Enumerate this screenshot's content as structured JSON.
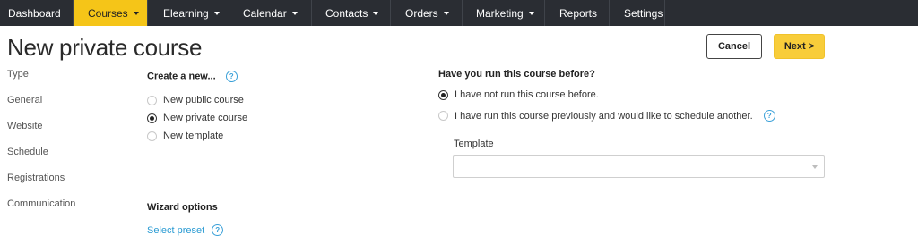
{
  "nav": {
    "items": [
      {
        "label": "Dashboard",
        "dropdown": false,
        "active": false
      },
      {
        "label": "Courses",
        "dropdown": true,
        "active": true
      },
      {
        "label": "Elearning",
        "dropdown": true,
        "active": false
      },
      {
        "label": "Calendar",
        "dropdown": true,
        "active": false
      },
      {
        "label": "Contacts",
        "dropdown": true,
        "active": false
      },
      {
        "label": "Orders",
        "dropdown": true,
        "active": false
      },
      {
        "label": "Marketing",
        "dropdown": true,
        "active": false
      },
      {
        "label": "Reports",
        "dropdown": false,
        "active": false
      },
      {
        "label": "Settings",
        "dropdown": false,
        "active": false
      }
    ]
  },
  "page": {
    "title": "New private course",
    "cancel_label": "Cancel",
    "next_label": "Next >"
  },
  "steps": [
    "Type",
    "General",
    "Website",
    "Schedule",
    "Registrations",
    "Communication"
  ],
  "create": {
    "heading": "Create a new...",
    "help": "?",
    "options": [
      {
        "label": "New public course",
        "checked": false
      },
      {
        "label": "New private course",
        "checked": true
      },
      {
        "label": "New template",
        "checked": false
      }
    ]
  },
  "wizard": {
    "heading": "Wizard options",
    "preset_link": "Select preset",
    "help": "?"
  },
  "run_before": {
    "heading": "Have you run this course before?",
    "options": [
      {
        "label": "I have not run this course before.",
        "checked": true
      },
      {
        "label": "I have run this course previously and would like to schedule another.",
        "checked": false
      }
    ],
    "help": "?",
    "template_label": "Template",
    "template_value": ""
  },
  "colors": {
    "nav_bg": "#2a2d33",
    "accent": "#f5c518",
    "link": "#2a9bd3"
  }
}
